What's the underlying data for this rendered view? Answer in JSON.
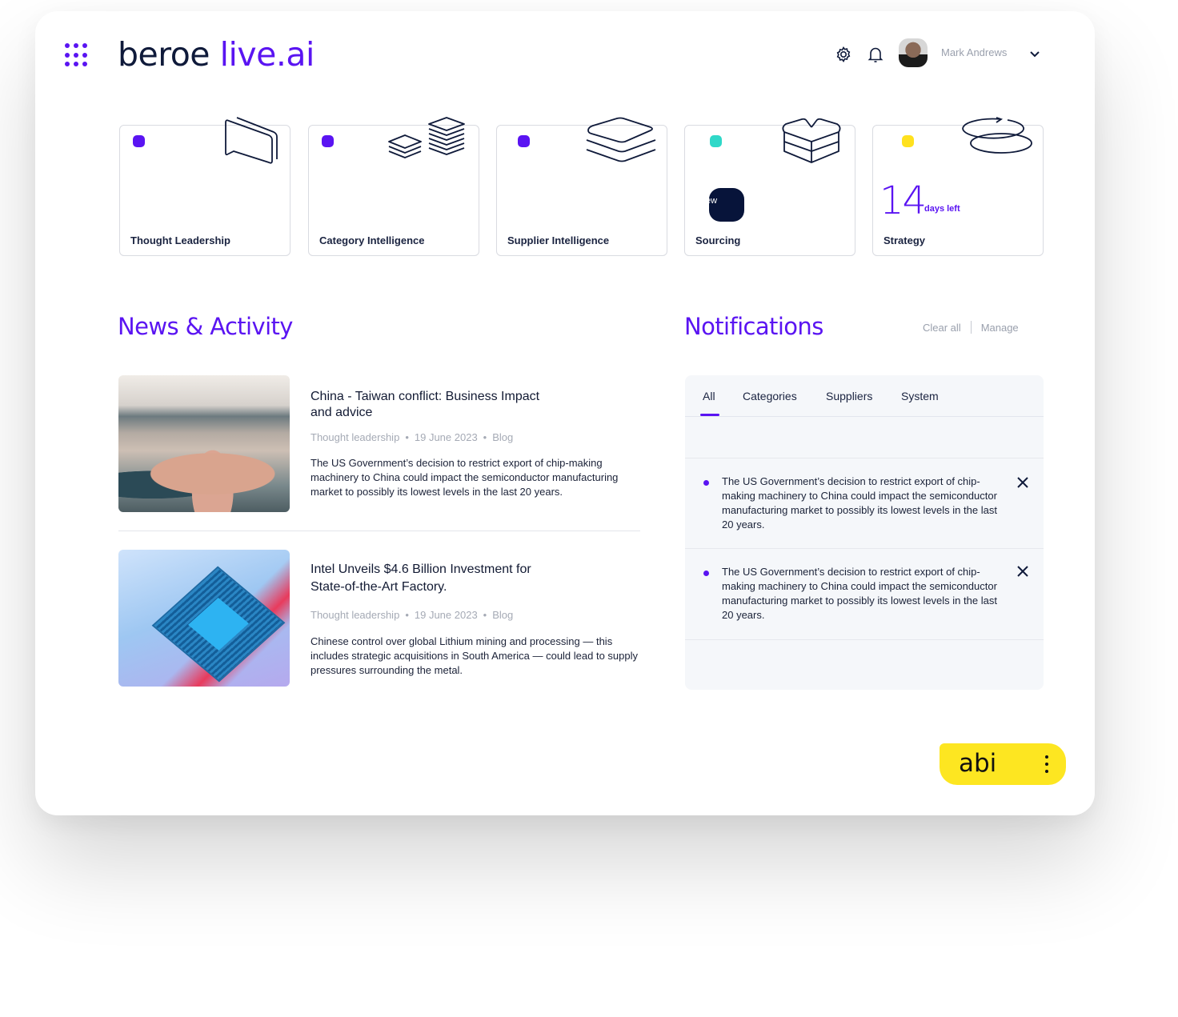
{
  "app": {
    "logo_part1": "beroe",
    "logo_part2": "live.ai",
    "apps_icon": "grid-dots-icon"
  },
  "header": {
    "icons": [
      "gear-icon",
      "bell-icon"
    ],
    "user_name": "Mark Andrews",
    "menu_icon": "chevron-down-icon"
  },
  "tiles": [
    {
      "label": "Thought Leadership",
      "dot_color": "#5a14f2",
      "icon": "speech-bubbles-icon"
    },
    {
      "label": "Category Intelligence",
      "dot_color": "#5a14f2",
      "icon": "stacked-layers-icon"
    },
    {
      "label": "Supplier Intelligence",
      "dot_color": "#5a14f2",
      "icon": "layers-icon"
    },
    {
      "label": "Sourcing",
      "dot_color": "#2fd8c8",
      "icon": "open-box-icon",
      "badge": "ew"
    },
    {
      "label": "Strategy",
      "dot_color": "#ffe11e",
      "icon": "rotate-discs-icon",
      "days_count": "14",
      "days_label": "days left"
    }
  ],
  "news": {
    "title": "News & Activity",
    "items": [
      {
        "title": "China - Taiwan conflict: Business Impact and advice",
        "category": "Thought leadership",
        "date": "19 June 2023",
        "type": "Blog",
        "body": "The US Government’s decision to restrict export of chip-making machinery to China could impact the semiconductor manufacturing market to possibly its lowest levels in the last 20 years.",
        "image": "airport-aerial-image"
      },
      {
        "title": "Intel Unveils $4.6 Billion Investment for State-of-the-Art Factory.",
        "category": "Thought leadership",
        "date": "19 June 2023",
        "type": "Blog",
        "body": "Chinese control over global Lithium mining and processing — this includes strategic acquisitions in South America — could lead to supply pressures surrounding the metal.",
        "image": "cpu-chip-image"
      }
    ],
    "bullet": "•"
  },
  "notifications": {
    "title": "Notifications",
    "clear_all": "Clear all",
    "manage": "Manage",
    "tabs": [
      {
        "label": "All",
        "active": true
      },
      {
        "label": "Categories",
        "active": false
      },
      {
        "label": "Suppliers",
        "active": false
      },
      {
        "label": "System",
        "active": false
      }
    ],
    "items": [
      {
        "text": "The US Government’s decision to restrict export of chip-making machinery to China could impact the semiconductor manufacturing market to possibly its lowest levels in the last 20 years."
      },
      {
        "text": "The US Government’s decision to restrict export of chip-making machinery to China could impact the semiconductor manufacturing market to possibly its lowest levels in the last 20 years."
      }
    ]
  },
  "assistant": {
    "label": "abi",
    "menu_icon": "more-vertical-icon"
  },
  "colors": {
    "brand": "#5a14f2",
    "ink": "#0f1a3a",
    "assistant": "#fde621"
  }
}
